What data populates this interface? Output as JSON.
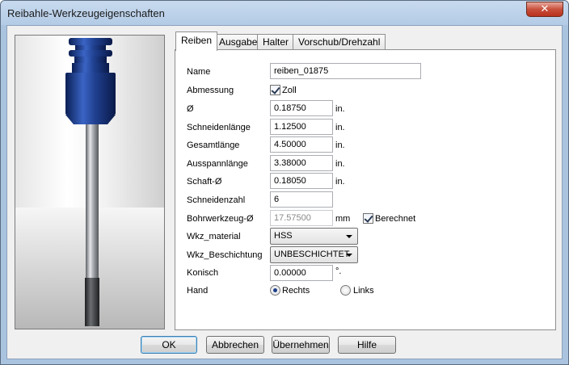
{
  "window": {
    "title": "Reibahle-Werkzeugeigenschaften",
    "close_symbol": "✕"
  },
  "tabs": [
    "Reiben",
    "Ausgabe",
    "Halter",
    "Vorschub/Drehzahl"
  ],
  "fields": {
    "name": {
      "label": "Name",
      "value": "reiben_01875"
    },
    "abmessung": {
      "label": "Abmessung",
      "checkbox_label": "Zoll",
      "checked": true
    },
    "durchmesser": {
      "label": "Ø",
      "value": "0.18750",
      "unit": "in."
    },
    "schneidenlaenge": {
      "label": "Schneidenlänge",
      "value": "1.12500",
      "unit": "in."
    },
    "gesamtlaenge": {
      "label": "Gesamtlänge",
      "value": "4.50000",
      "unit": "in."
    },
    "ausspannlaenge": {
      "label": "Ausspannlänge",
      "value": "3.38000",
      "unit": "in."
    },
    "schaft": {
      "label": "Schaft-Ø",
      "value": "0.18050",
      "unit": "in."
    },
    "schneidenzahl": {
      "label": "Schneidenzahl",
      "value": "6"
    },
    "bohrwerkzeug": {
      "label": "Bohrwerkzeug-Ø",
      "value": "17.57500",
      "unit": "mm",
      "checkbox_label": "Berechnet",
      "checked": true
    },
    "material": {
      "label": "Wkz_material",
      "value": "HSS"
    },
    "beschichtung": {
      "label": "Wkz_Beschichtung",
      "value": "UNBESCHICHTET"
    },
    "konisch": {
      "label": "Konisch",
      "value": "0.00000",
      "unit": "°."
    },
    "hand": {
      "label": "Hand",
      "option_right": "Rechts",
      "option_left": "Links",
      "selected": "Rechts"
    }
  },
  "buttons": {
    "ok": "OK",
    "cancel": "Abbrechen",
    "apply": "Übernehmen",
    "help": "Hilfe"
  },
  "colors": {
    "tool_blue": "#1f3f8e",
    "titlebar": "#b9cfe8"
  }
}
